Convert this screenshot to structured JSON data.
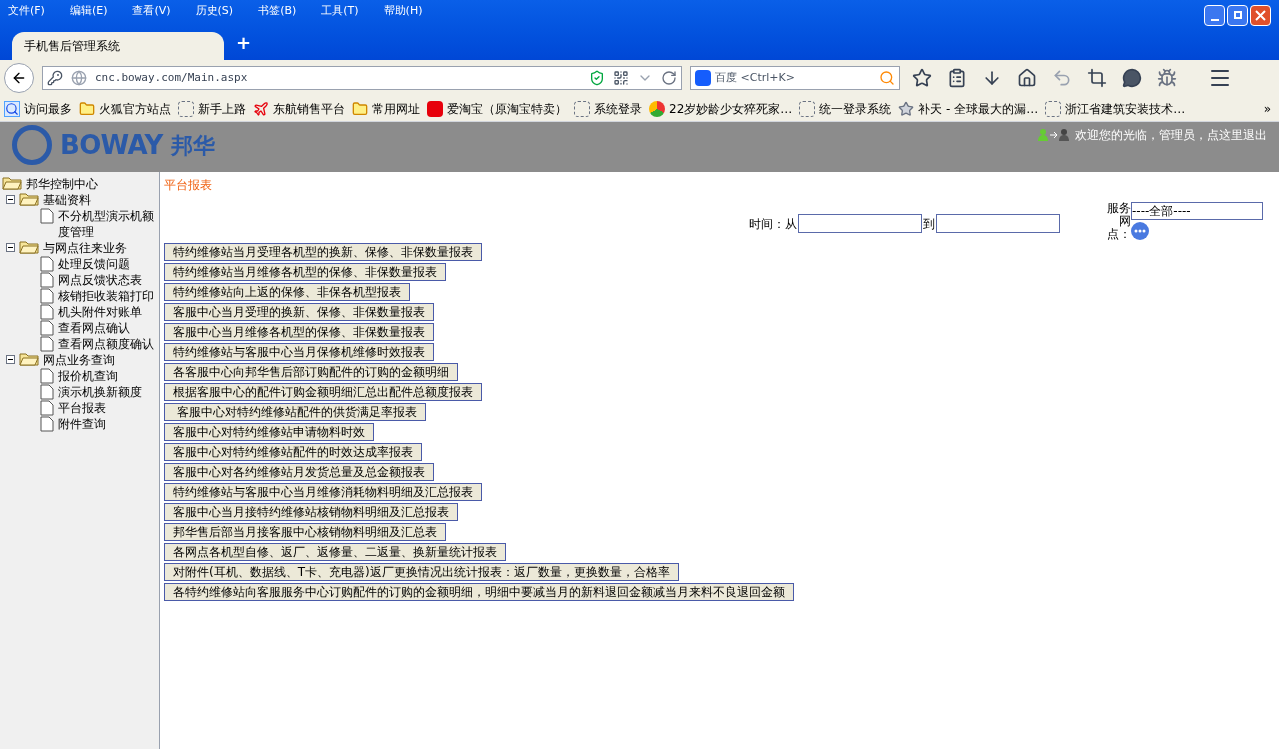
{
  "menu": [
    "文件(F)",
    "编辑(E)",
    "查看(V)",
    "历史(S)",
    "书签(B)",
    "工具(T)",
    "帮助(H)"
  ],
  "tabs": [
    {
      "label": "手机售后管理系统",
      "selected": true
    }
  ],
  "new_tab": "+",
  "address": "cnc.boway.com/Main.aspx",
  "search": {
    "placeholder": "百度 <Ctrl+K>"
  },
  "bookmarks": [
    {
      "label": "访问最多",
      "kind": "special"
    },
    {
      "label": "火狐官方站点",
      "kind": "folder"
    },
    {
      "label": "新手上路",
      "kind": "page"
    },
    {
      "label": "东航销售平台",
      "kind": "airline"
    },
    {
      "label": "常用网址",
      "kind": "folder"
    },
    {
      "label": "爱淘宝（原淘宝特卖）",
      "kind": "taobao"
    },
    {
      "label": "系统登录",
      "kind": "page"
    },
    {
      "label": "22岁妙龄少女猝死家…",
      "kind": "news"
    },
    {
      "label": "统一登录系统",
      "kind": "page"
    },
    {
      "label": "补天 - 全球最大的漏…",
      "kind": "star"
    },
    {
      "label": "浙江省建筑安装技术…",
      "kind": "page"
    }
  ],
  "bookmarks_more": "»",
  "header": {
    "logo_text": "BOWAY",
    "logo_cn": "邦华",
    "welcome": "欢迎您的光临，管理员，点这里退出"
  },
  "tree": [
    {
      "label": "邦华控制中心",
      "expanded": true,
      "children": [
        {
          "label": "基础资料",
          "expanded": true,
          "children": [
            {
              "label": "不分机型演示机额度管理"
            }
          ]
        },
        {
          "label": "与网点往来业务",
          "expanded": true,
          "children": [
            {
              "label": "处理反馈问题"
            },
            {
              "label": "网点反馈状态表"
            },
            {
              "label": "核销拒收装箱打印"
            },
            {
              "label": "机头附件对账单"
            },
            {
              "label": "查看网点确认"
            },
            {
              "label": "查看网点额度确认"
            }
          ]
        },
        {
          "label": "网点业务查询",
          "expanded": true,
          "children": [
            {
              "label": "报价机查询"
            },
            {
              "label": "演示机换新额度"
            },
            {
              "label": "平台报表"
            },
            {
              "label": "附件查询"
            }
          ]
        }
      ]
    }
  ],
  "breadcrumb": "平台报表",
  "filters": {
    "time_label": "时间：从",
    "to_label": "到",
    "outlet_label": "服务网点：",
    "outlet_value": "----全部----"
  },
  "reports": [
    "特约维修站当月受理各机型的换新、保修、非保数量报表",
    "特约维修站当月维修各机型的保修、非保数量报表",
    "特约维修站向上返的保修、非保各机型报表",
    "客服中心当月受理的换新、保修、非保数量报表",
    "客服中心当月维修各机型的保修、非保数量报表",
    "特约维修站与客服中心当月保修机维修时效报表",
    "各客服中心向邦华售后部订购配件的订购的金额明细",
    "根据客服中心的配件订购金额明细汇总出配件总额度报表",
    " 客服中心对特约维修站配件的供货满足率报表",
    "客服中心对特约维修站申请物料时效",
    "客服中心对特约维修站配件的时效达成率报表",
    "客服中心对各约维修站月发货总量及总金额报表",
    "特约维修站与客服中心当月维修消耗物料明细及汇总报表",
    "客服中心当月接特约维修站核销物料明细及汇总报表",
    "邦华售后部当月接客服中心核销物料明细及汇总表",
    "各网点各机型自修、返厂、返修量、二返量、换新量统计报表",
    "对附件(耳机、数据线、T卡、充电器)返厂更换情况出统计报表：返厂数量，更换数量，合格率",
    "各特约维修站向客服服务中心订购配件的订购的金额明细，明细中要减当月的新料退回金额减当月来料不良退回金额"
  ]
}
